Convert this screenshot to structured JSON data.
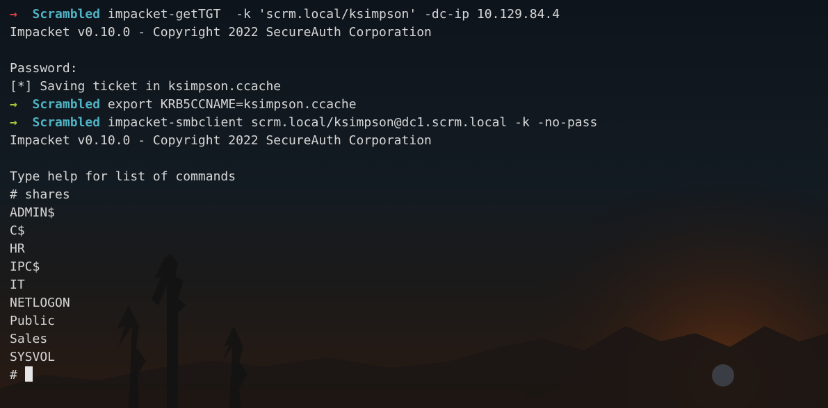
{
  "theme": {
    "text_color": "#d6d6d6",
    "arrow_fail_color": "#e0433c",
    "arrow_ok_color": "#a3c93a",
    "host_color": "#4fb3c4",
    "cursor_color": "#e6e6e6"
  },
  "terminal": {
    "lines": [
      {
        "type": "prompt",
        "status": "fail",
        "arrow": "→",
        "host": "Scrambled",
        "command": "impacket-getTGT  -k 'scrm.local/ksimpson' -dc-ip 10.129.84.4"
      },
      {
        "type": "output",
        "text": "Impacket v0.10.0 - Copyright 2022 SecureAuth Corporation"
      },
      {
        "type": "output",
        "text": ""
      },
      {
        "type": "output",
        "text": "Password:"
      },
      {
        "type": "output",
        "text": "[*] Saving ticket in ksimpson.ccache"
      },
      {
        "type": "prompt",
        "status": "ok",
        "arrow": "→",
        "host": "Scrambled",
        "command": "export KRB5CCNAME=ksimpson.ccache"
      },
      {
        "type": "prompt",
        "status": "ok",
        "arrow": "→",
        "host": "Scrambled",
        "command": "impacket-smbclient scrm.local/ksimpson@dc1.scrm.local -k -no-pass"
      },
      {
        "type": "output",
        "text": "Impacket v0.10.0 - Copyright 2022 SecureAuth Corporation"
      },
      {
        "type": "output",
        "text": ""
      },
      {
        "type": "output",
        "text": "Type help for list of commands"
      },
      {
        "type": "output",
        "text": "# shares"
      },
      {
        "type": "output",
        "text": "ADMIN$"
      },
      {
        "type": "output",
        "text": "C$"
      },
      {
        "type": "output",
        "text": "HR"
      },
      {
        "type": "output",
        "text": "IPC$"
      },
      {
        "type": "output",
        "text": "IT"
      },
      {
        "type": "output",
        "text": "NETLOGON"
      },
      {
        "type": "output",
        "text": "Public"
      },
      {
        "type": "output",
        "text": "Sales"
      },
      {
        "type": "output",
        "text": "SYSVOL"
      },
      {
        "type": "input",
        "prompt": "# ",
        "value": ""
      }
    ]
  }
}
